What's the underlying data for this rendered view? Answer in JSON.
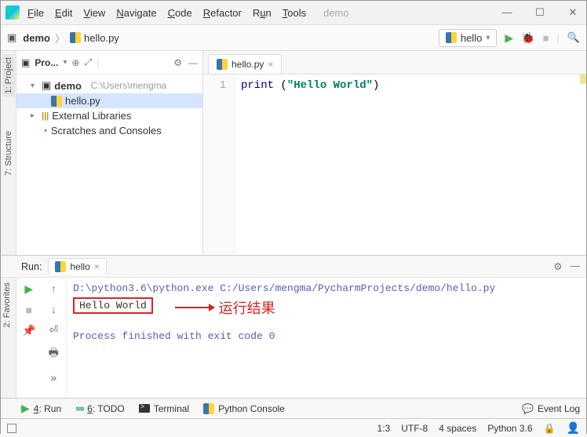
{
  "titlebar": {
    "app_hint": "demo"
  },
  "menu": {
    "file": "File",
    "edit": "Edit",
    "view": "View",
    "navigate": "Navigate",
    "code": "Code",
    "refactor": "Refactor",
    "run": "Run",
    "tools": "Tools"
  },
  "breadcrumb": {
    "project": "demo",
    "file": "hello.py"
  },
  "run_config": {
    "label": "hello"
  },
  "left_tabs": {
    "project": "1: Project",
    "structure": "7: Structure",
    "favorites": "2: Favorites"
  },
  "project_panel": {
    "title": "Pro...",
    "tree": {
      "root": {
        "name": "demo",
        "path": "C:\\Users\\mengma"
      },
      "file": "hello.py",
      "ext_lib": "External Libraries",
      "scratches": "Scratches and Consoles"
    }
  },
  "editor": {
    "tab": "hello.py",
    "line_no": "1",
    "code": {
      "fn": "print",
      "sp": " ",
      "lp": "(",
      "str": "\"Hello World\"",
      "rp": ")"
    }
  },
  "run_panel": {
    "title": "Run:",
    "tab": "hello",
    "console": {
      "path": "D:\\python3.6\\python.exe C:/Users/mengma/PycharmProjects/demo/hello.py",
      "output": "Hello World",
      "annotation": "运行结果",
      "exit": "Process finished with exit code 0"
    }
  },
  "bottom": {
    "run": "4: Run",
    "todo": "6: TODO",
    "terminal": "Terminal",
    "pyconsole": "Python Console",
    "eventlog": "Event Log"
  },
  "status": {
    "pos": "1:3",
    "enc": "UTF-8",
    "indent": "4 spaces",
    "interp": "Python 3.6"
  }
}
